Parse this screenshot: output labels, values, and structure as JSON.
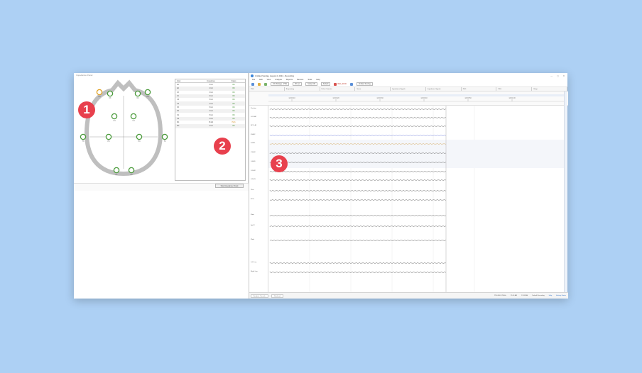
{
  "badges": [
    "1",
    "2",
    "3"
  ],
  "impedance": {
    "title": "Impedance Panel",
    "electrodes": [
      {
        "name": "F3",
        "color": "#4a9a3a"
      },
      {
        "name": "F4",
        "color": "#4a9a3a"
      },
      {
        "name": "C3",
        "color": "#4a9a3a"
      },
      {
        "name": "C4",
        "color": "#4a9a3a"
      },
      {
        "name": "P3",
        "color": "#4a9a3a"
      },
      {
        "name": "P4",
        "color": "#4a9a3a"
      },
      {
        "name": "T3",
        "color": "#4a9a3a"
      },
      {
        "name": "T4",
        "color": "#4a9a3a"
      },
      {
        "name": "O1",
        "color": "#4a9a3a"
      },
      {
        "name": "O2",
        "color": "#4a9a3a"
      },
      {
        "name": "M1",
        "color": "#e0a020"
      },
      {
        "name": "M2",
        "color": "#4a9a3a"
      }
    ],
    "table": {
      "headers": [
        "Input",
        "Impedance",
        "Status"
      ],
      "rows": [
        [
          "E1",
          "5 kΩ",
          "OK"
        ],
        [
          "E2",
          "4 kΩ",
          "OK"
        ],
        [
          "F3",
          "3 kΩ",
          "OK"
        ],
        [
          "F4",
          "6 kΩ",
          "OK"
        ],
        [
          "C3",
          "5 kΩ",
          "OK"
        ],
        [
          "C4",
          "4 kΩ",
          "OK"
        ],
        [
          "P3",
          "5 kΩ",
          "OK"
        ],
        [
          "P4",
          "3 kΩ",
          "OK"
        ],
        [
          "O1",
          "5 kΩ",
          "OK"
        ],
        [
          "O2",
          "4 kΩ",
          "OK"
        ],
        [
          "M1",
          "15 kΩ",
          "High"
        ],
        [
          "M2",
          "3 kΩ",
          "OK"
        ]
      ]
    },
    "stop_button": "Stop Impedance Check"
  },
  "app": {
    "title": "Untitled Sunday, August 4, 2024 - Recording",
    "window_controls": [
      "—",
      "▢",
      "✕"
    ],
    "menu": [
      "File",
      "Edit",
      "View",
      "Analysis",
      "Reports",
      "Devices",
      "Tools",
      "Help"
    ],
    "toolbar": {
      "channel_select": "Ch Montage - PSG",
      "view": "30 sec",
      "scale": "Scale 100",
      "mode": "Default",
      "record": "REC_00:00",
      "scoring": "Untitled Scoring"
    },
    "channel_bar": [
      "PSG",
      "Respiratory",
      "Pulse Oximeter",
      "Snore",
      "Impedance Signals",
      "Impedance Signals",
      "PSG",
      "PSG",
      "Sleep"
    ],
    "timeline_times": [
      "14:00:10",
      "14:00:20",
      "14:00:30",
      "14:00:40",
      "14:00:50",
      "14:01:00"
    ],
    "trace_labels": [
      "Position",
      "LOC-A2",
      "ROC-A1",
      "F3-M2",
      "F4-M1",
      "C3-M2",
      "C4-M1",
      "O1-M2",
      "O2-M1",
      "Chin",
      "ECG",
      "Flow",
      "SpO2",
      "Pleth",
      "Left Leg",
      "Right Leg"
    ],
    "status": {
      "tabs": [
        "Analysis Console",
        "Notebook"
      ],
      "right": [
        "PSG EEG 256Hz",
        "12:00 AM",
        "12:08 AM",
        "Default Recording",
        "Help"
      ],
      "link": "Activity Status"
    }
  }
}
